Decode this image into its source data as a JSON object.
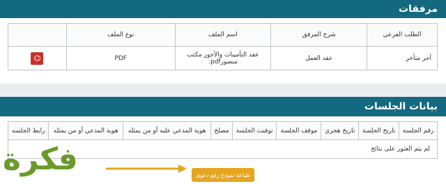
{
  "attachments": {
    "title": "مرفقات",
    "headers": [
      "الطلب الفرعي",
      "شرح المرفق",
      "اسم الملف",
      "نوع الملف",
      ""
    ],
    "rows": [
      {
        "sub_request": "أجر متأخر",
        "description": "عقد العمل",
        "file_name": "عقد التأمينات والأجور مكتب منصورpdf.",
        "file_type": "PDF",
        "icon": "pdf-icon"
      }
    ]
  },
  "sessions": {
    "title": "بيانات الجلسات",
    "headers": [
      "رقم الجلسة",
      "تاريخ الجلسة",
      "تاريخ هجري",
      "موقف الجلسة",
      "توقيت الجلسة",
      "مصلح",
      "هوية المدعي عليه أو من يمثله",
      "هوية المدعي أو من يمثله",
      "رابط الجلسه"
    ],
    "empty_message": "لم يتم العثور على نتائج"
  },
  "print_button_label": "طباعة نموذج رفع دعوى",
  "watermark_text": "فكرة",
  "colors": {
    "header": "#13697f",
    "button": "#e7a51f",
    "logo": "#6a9a2a"
  }
}
